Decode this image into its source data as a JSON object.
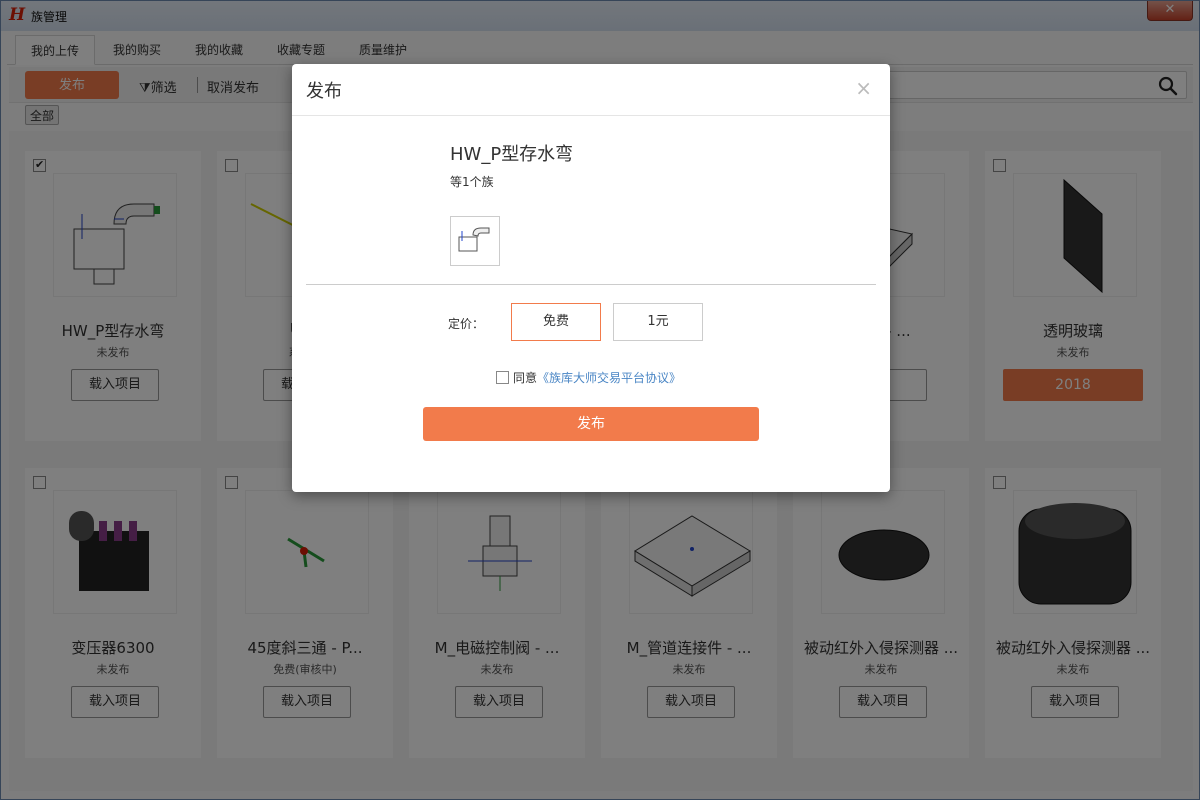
{
  "window": {
    "title": "族管理",
    "logo": "H",
    "close": "✕"
  },
  "tabs": [
    {
      "label": "我的上传"
    },
    {
      "label": "我的购买"
    },
    {
      "label": "我的收藏"
    },
    {
      "label": "收藏专题"
    },
    {
      "label": "质量维护"
    }
  ],
  "toolbar": {
    "publish": "发布",
    "filter": "筛选",
    "cancel_publish": "取消发布",
    "filter_tag": "全部"
  },
  "cards": [
    {
      "name": "HW_P型存水弯",
      "status": "未发布",
      "button": "载入项目",
      "checked": true
    },
    {
      "name": "UPV",
      "status": "系统族",
      "button": "载入项目"
    },
    {
      "name": "",
      "status": "",
      "button": ""
    },
    {
      "name": "",
      "status": "",
      "button": ""
    },
    {
      "name": "接件 - ...",
      "status": "布",
      "button": "目"
    },
    {
      "name": "透明玻璃",
      "status": "未发布",
      "button": "2018"
    },
    {
      "name": "变压器6300",
      "status": "未发布",
      "button": "载入项目"
    },
    {
      "name": "45度斜三通 - P...",
      "status": "免费(审核中)",
      "button": "载入项目"
    },
    {
      "name": "M_电磁控制阀 - ...",
      "status": "未发布",
      "button": "载入项目"
    },
    {
      "name": "M_管道连接件 - ...",
      "status": "未发布",
      "button": "载入项目"
    },
    {
      "name": "被动红外入侵探测器 ...",
      "status": "未发布",
      "button": "载入项目"
    },
    {
      "name": "被动红外入侵探测器 ...",
      "status": "未发布",
      "button": "载入项目"
    }
  ],
  "modal": {
    "title": "发布",
    "close": "×",
    "family_name": "HW_P型存水弯",
    "count": "等1个族",
    "price_label": "定价：",
    "price_free": "免费",
    "price_paid": "1元",
    "agree_text": "同意",
    "agree_link": "《族库大师交易平台协议》",
    "submit": "发布"
  },
  "colors": {
    "accent": "#f27b4b",
    "link": "#4a86c5"
  }
}
